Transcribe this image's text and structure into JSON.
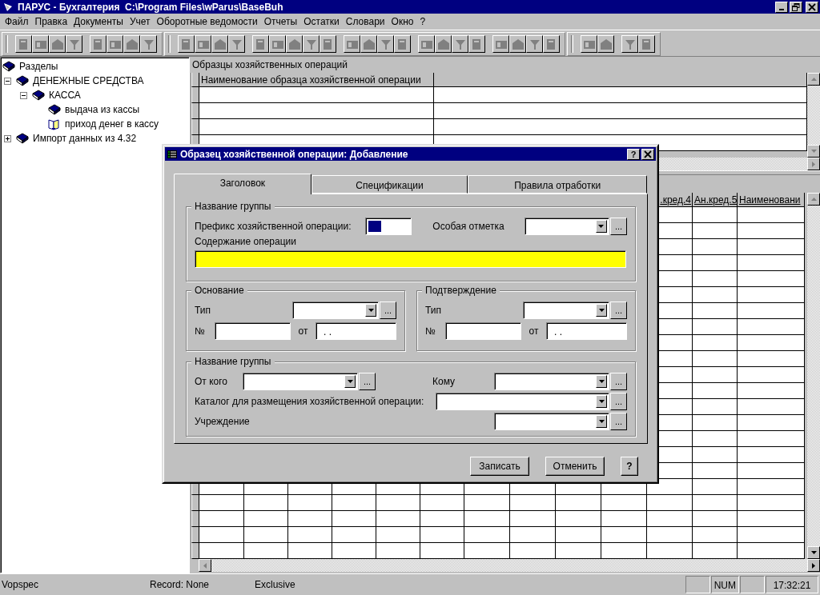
{
  "window": {
    "title": "ПАРУС - Бухгалтерия  C:\\Program Files\\wParus\\BaseBuh"
  },
  "menu": [
    {
      "label": "Файл"
    },
    {
      "label": "Правка"
    },
    {
      "label": "Документы"
    },
    {
      "label": "Учет"
    },
    {
      "label": "Оборотные ведомости"
    },
    {
      "label": "Отчеты"
    },
    {
      "label": "Остатки"
    },
    {
      "label": "Словари"
    },
    {
      "label": "Окно"
    },
    {
      "label": "?"
    }
  ],
  "tree": {
    "items": [
      {
        "label": "Разделы",
        "selected": false,
        "children": [
          {
            "label": "ДЕНЕЖНЫЕ СРЕДСТВА",
            "selected": false,
            "expanded": true,
            "children": [
              {
                "label": "КАССА",
                "selected": false,
                "expanded": true,
                "children": [
                  {
                    "label": "выдача из кассы",
                    "selected": false
                  },
                  {
                    "label": "приход денег в кассу",
                    "selected": true
                  }
                ]
              }
            ]
          },
          {
            "label": "Импорт данных из 4.32",
            "selected": false,
            "expanded": false
          }
        ]
      }
    ]
  },
  "top_grid": {
    "title": "Образцы хозяйственных операций",
    "columns": [
      {
        "label": "Наименование образца хозяйственной операции"
      }
    ]
  },
  "bottom_grid": {
    "columns": [
      {
        "label": ".кред.4"
      },
      {
        "label": "Ан.кред.5"
      },
      {
        "label": "Наименовани"
      }
    ]
  },
  "dialog": {
    "title": "Образец хозяйственной операции: Добавление",
    "help_button": "?",
    "tabs": [
      {
        "label": "Заголовок",
        "selected": true
      },
      {
        "label": "Спецификации",
        "selected": false
      },
      {
        "label": "Правила отработки",
        "selected": false
      }
    ],
    "header_group": {
      "legend": "Название группы",
      "prefix_label": "Префикс хозяйственной операции:",
      "prefix_focused": true,
      "mark_label": "Особая отметка",
      "browse": "...",
      "content_label": "Содержание операции",
      "content_required": true
    },
    "basis": {
      "legend": "Основание",
      "type_label": "Тип",
      "browse": "...",
      "number_label": "№",
      "date_label": "от",
      "date_value": ". ."
    },
    "confirmation": {
      "legend": "Подтверждение",
      "type_label": "Тип",
      "browse": "...",
      "number_label": "№",
      "date_label": "от",
      "date_value": ". ."
    },
    "parties": {
      "legend": "Название группы",
      "from_label": "От кого",
      "from_browse": "...",
      "to_label": "Кому",
      "to_browse": "...",
      "catalog_label": "Каталог для размещения хозяйственной операции:",
      "catalog_browse": "...",
      "institution_label": "Учреждение",
      "institution_browse": "..."
    },
    "buttons": [
      {
        "label": "Записать"
      },
      {
        "label": "Отменить"
      },
      {
        "label": "?"
      }
    ]
  },
  "status_bar": {
    "panels": [
      {
        "text": "Vopspec"
      },
      {
        "text": "Record: None"
      },
      {
        "text": "Exclusive"
      }
    ],
    "indicators": [
      {
        "text": "NUM"
      },
      {
        "text": "17:32:21"
      }
    ]
  }
}
